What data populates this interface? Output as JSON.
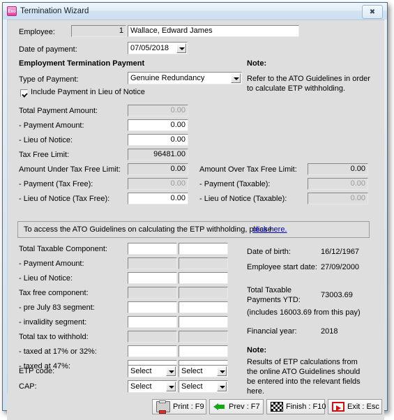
{
  "window": {
    "title": "Termination Wizard",
    "icon": "exo-app-icon",
    "close_label": "✖"
  },
  "header": {
    "employee_label": "Employee:",
    "employee_code": "1",
    "employee_name": "Wallace, Edward James",
    "date_label": "Date of payment:",
    "date_value": "07/05/2018",
    "section_title": "Employment Termination Payment",
    "note_label": "Note:",
    "note_text_line1": "Refer to the ATO Guidelines in order",
    "note_text_line2": "to calculate ETP withholding."
  },
  "payment": {
    "type_label": "Type of Payment:",
    "type_value": "Genuine Redundancy",
    "include_lieu_label": "Include Payment in Lieu of Notice",
    "include_lieu_checked": true,
    "rows": [
      {
        "label": "Total Payment Amount:",
        "value": "0.00",
        "readonly": true
      },
      {
        "label": "   - Payment Amount:",
        "value": "0.00",
        "readonly": false
      },
      {
        "label": "   - Lieu of Notice:",
        "value": "0.00",
        "readonly": false
      },
      {
        "label": "Tax Free Limit:",
        "value": "96481.00",
        "readonly": true,
        "dark": true
      }
    ]
  },
  "limits": {
    "left": [
      {
        "label": "Amount Under Tax Free Limit:",
        "value": "0.00",
        "readonly": true,
        "dark": true
      },
      {
        "label": "   - Payment (Tax Free):",
        "value": "0.00",
        "readonly": true
      },
      {
        "label": "   - Lieu of Notice (Tax Free):",
        "value": "0.00",
        "readonly": false
      }
    ],
    "right": [
      {
        "label": "Amount Over Tax Free Limit:",
        "value": "0.00",
        "readonly": true,
        "dark": true
      },
      {
        "label": "   - Payment (Taxable):",
        "value": "0.00",
        "readonly": true
      },
      {
        "label": "   - Lieu of Notice (Taxable):",
        "value": "0.00",
        "readonly": true
      }
    ]
  },
  "link_panel": {
    "text": "To access the ATO Guidelines on calculating the ETP withholding, please",
    "link_text": "click here."
  },
  "components": {
    "rows": [
      {
        "label": "Total Taxable Component:",
        "col1": "",
        "col2": "",
        "readonly": false
      },
      {
        "label": "   - Payment Amount:",
        "col1": "",
        "col2": "",
        "readonly": true
      },
      {
        "label": "   - Lieu of Notice:",
        "col1": "",
        "col2": "",
        "readonly": false
      },
      {
        "label": "Tax free component:",
        "col1": "",
        "col2": "",
        "readonly": true
      },
      {
        "label": "   - pre July 83 segment:",
        "col1": "",
        "col2": "",
        "readonly": false
      },
      {
        "label": "   - invalidity segment:",
        "col1": "",
        "col2": "",
        "readonly": false
      },
      {
        "label": "Total tax to withhold:",
        "col1": "",
        "col2": "",
        "readonly": true
      },
      {
        "label": "   - taxed at 17% or 32%:",
        "col1": "",
        "col2": "",
        "readonly": false
      },
      {
        "label": "   - taxed at 47%:",
        "col1": "",
        "col2": "",
        "readonly": false
      }
    ],
    "selects": [
      {
        "label": "ETP code:",
        "col1": "Select",
        "col2": "Select"
      },
      {
        "label": "CAP:",
        "col1": "Select",
        "col2": "Select"
      }
    ]
  },
  "info": {
    "dob_label": "Date of birth:",
    "dob_value": "16/12/1967",
    "start_label": "Employee start date:",
    "start_value": "27/09/2000",
    "ytd_label_line1": "Total Taxable",
    "ytd_label_line2": "Payments YTD:",
    "ytd_value": "73003.69",
    "ytd_note": "(includes 16003.69 from this pay)",
    "fy_label": "Financial year:",
    "fy_value": "2018",
    "note_label": "Note:",
    "note_line1": "Results of ETP calculations from",
    "note_line2": "the online ATO Guidelines should",
    "note_line3": "be entered into the relevant fields",
    "note_line4": "here."
  },
  "footer": {
    "buttons": [
      {
        "label": "Print : F9",
        "icon": "printer-icon"
      },
      {
        "label": "Prev : F7",
        "icon": "left-arrow-icon"
      },
      {
        "label": "Finish : F10",
        "icon": "checkered-flag-icon"
      },
      {
        "label": "Exit : Esc",
        "icon": "exit-door-icon"
      }
    ]
  }
}
